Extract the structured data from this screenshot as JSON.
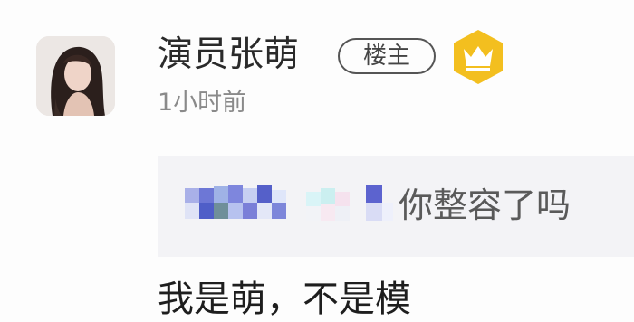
{
  "post": {
    "author": {
      "name": "演员张萌",
      "badge": "楼主",
      "crown_color": "#f3bf1f",
      "timestamp": "1小时前"
    },
    "quote": {
      "username_obscured": true,
      "text": "你整容了吗"
    },
    "reply_text": "我是萌，不是模"
  }
}
